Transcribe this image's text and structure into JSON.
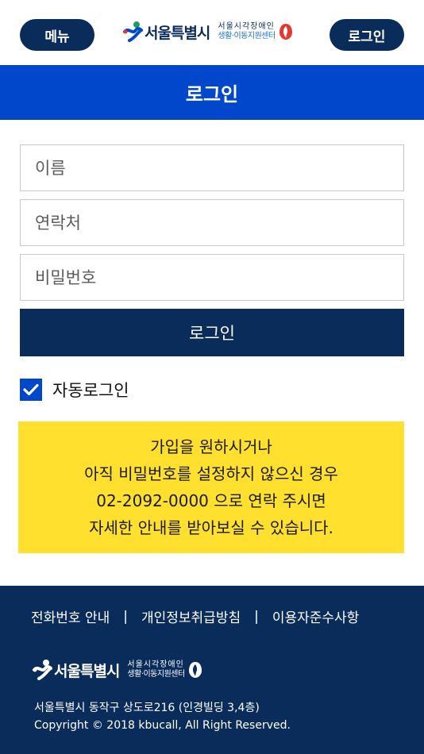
{
  "header": {
    "menu_label": "메뉴",
    "login_label": "로그인",
    "logo_city": "서울특별시",
    "logo_center_line1": "서울시각장애인",
    "logo_center_line2": "생활·이동지원센터"
  },
  "title": "로그인",
  "form": {
    "name_placeholder": "이름",
    "contact_placeholder": "연락처",
    "password_placeholder": "비밀번호",
    "submit_label": "로그인",
    "auto_login_label": "자동로그인",
    "auto_login_checked": true
  },
  "notice": {
    "line1": "가입을 원하시거나",
    "line2": "아직 비밀번호를 설정하지 않으신 경우",
    "line3": "02-2092-0000 으로 연락 주시면",
    "line4": "자세한 안내를 받아보실 수 있습니다."
  },
  "footer": {
    "link_phone": "전화번호 안내",
    "link_privacy": "개인정보취급방침",
    "link_terms": "이용자준수사항",
    "separator": "|",
    "logo_city": "서울특별시",
    "logo_center_line1": "서울시각장애인",
    "logo_center_line2": "생활·이동지원센터",
    "address": "서울특별시 동작구 상도로216 (인경빌딩 3,4층)",
    "copyright": "Copyright © 2018 kbucall, All Right Reserved."
  },
  "colors": {
    "navy": "#0a2c5a",
    "blue": "#0047cc",
    "notice_yellow": "#ffe02e"
  }
}
